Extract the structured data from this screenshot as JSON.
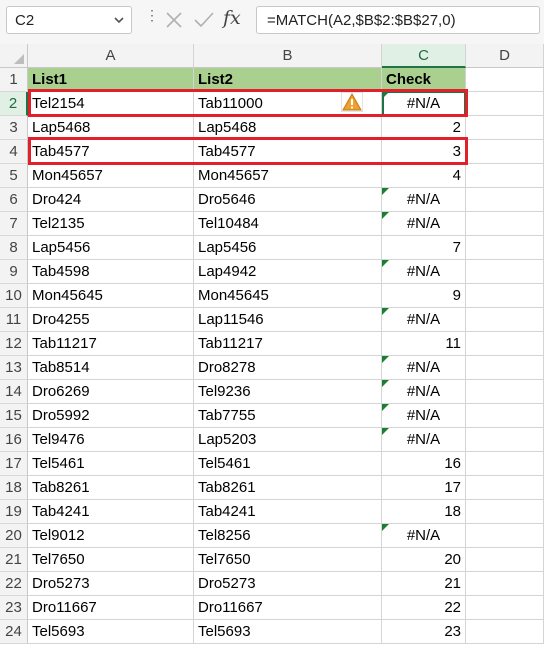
{
  "formula_bar": {
    "name_box": "C2",
    "formula": "=MATCH(A2,$B$2:$B$27,0)",
    "fx_label": "fx",
    "menu_glyph": "⋮"
  },
  "columns": [
    "A",
    "B",
    "C",
    "D"
  ],
  "sheet": {
    "header_row": {
      "row": "1",
      "a": "List1",
      "b": "List2",
      "c": "Check"
    },
    "rows": [
      {
        "row": "2",
        "a": "Tel2154",
        "b": "Tab11000",
        "c": "#N/A"
      },
      {
        "row": "3",
        "a": "Lap5468",
        "b": "Lap5468",
        "c": "2"
      },
      {
        "row": "4",
        "a": "Tab4577",
        "b": "Tab4577",
        "c": "3"
      },
      {
        "row": "5",
        "a": "Mon45657",
        "b": "Mon45657",
        "c": "4"
      },
      {
        "row": "6",
        "a": "Dro424",
        "b": "Dro5646",
        "c": "#N/A"
      },
      {
        "row": "7",
        "a": "Tel2135",
        "b": "Tel10484",
        "c": "#N/A"
      },
      {
        "row": "8",
        "a": "Lap5456",
        "b": "Lap5456",
        "c": "7"
      },
      {
        "row": "9",
        "a": "Tab4598",
        "b": "Lap4942",
        "c": "#N/A"
      },
      {
        "row": "10",
        "a": "Mon45645",
        "b": "Mon45645",
        "c": "9"
      },
      {
        "row": "11",
        "a": "Dro4255",
        "b": "Lap11546",
        "c": "#N/A"
      },
      {
        "row": "12",
        "a": "Tab11217",
        "b": "Tab11217",
        "c": "11"
      },
      {
        "row": "13",
        "a": "Tab8514",
        "b": "Dro8278",
        "c": "#N/A"
      },
      {
        "row": "14",
        "a": "Dro6269",
        "b": "Tel9236",
        "c": "#N/A"
      },
      {
        "row": "15",
        "a": "Dro5992",
        "b": "Tab7755",
        "c": "#N/A"
      },
      {
        "row": "16",
        "a": "Tel9476",
        "b": "Lap5203",
        "c": "#N/A"
      },
      {
        "row": "17",
        "a": "Tel5461",
        "b": "Tel5461",
        "c": "16"
      },
      {
        "row": "18",
        "a": "Tab8261",
        "b": "Tab8261",
        "c": "17"
      },
      {
        "row": "19",
        "a": "Tab4241",
        "b": "Tab4241",
        "c": "18"
      },
      {
        "row": "20",
        "a": "Tel9012",
        "b": "Tel8256",
        "c": "#N/A"
      },
      {
        "row": "21",
        "a": "Tel7650",
        "b": "Tel7650",
        "c": "20"
      },
      {
        "row": "22",
        "a": "Dro5273",
        "b": "Dro5273",
        "c": "21"
      },
      {
        "row": "23",
        "a": "Dro11667",
        "b": "Dro11667",
        "c": "22"
      },
      {
        "row": "24",
        "a": "Tel5693",
        "b": "Tel5693",
        "c": "23"
      }
    ]
  },
  "colors": {
    "header_fill": "#a9d08e",
    "highlight_border": "#e1202c",
    "selection_border": "#217346",
    "error_flag": "#1e7e34",
    "warning_icon": "#f0a030"
  }
}
